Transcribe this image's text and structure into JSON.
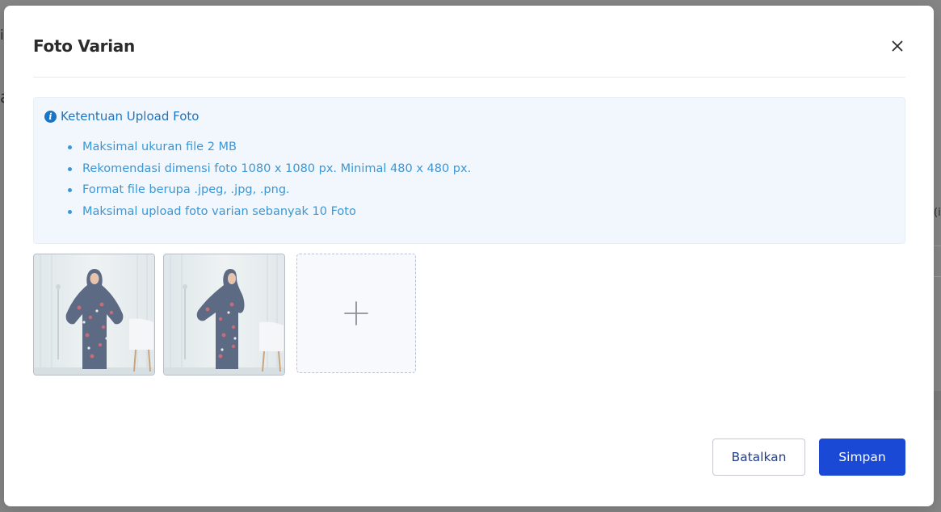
{
  "background_page": {
    "fragment_a": "i",
    "fragment_b": "a",
    "fragment_c": "(i"
  },
  "modal": {
    "title": "Foto Varian",
    "close_icon": "close-icon"
  },
  "info": {
    "icon": "info-icon",
    "icon_glyph": "i",
    "heading": "Ketentuan Upload Foto",
    "rules": [
      "Maksimal ukuran file 2 MB",
      "Rekomendasi dimensi foto 1080 x 1080 px. Minimal 480 x 480 px.",
      "Format file berupa .jpeg, .jpg, .png.",
      "Maksimal upload foto varian sebanyak 10 Foto"
    ]
  },
  "photos": [
    {
      "name": "variant-photo-1",
      "pose": "front"
    },
    {
      "name": "variant-photo-2",
      "pose": "side"
    }
  ],
  "add_photo": {
    "icon": "plus-icon"
  },
  "buttons": {
    "cancel_label": "Batalkan",
    "save_label": "Simpan"
  },
  "colors": {
    "primary": "#1a49d6",
    "info_text": "#3c96d4",
    "info_bg": "#f1f7fd"
  }
}
